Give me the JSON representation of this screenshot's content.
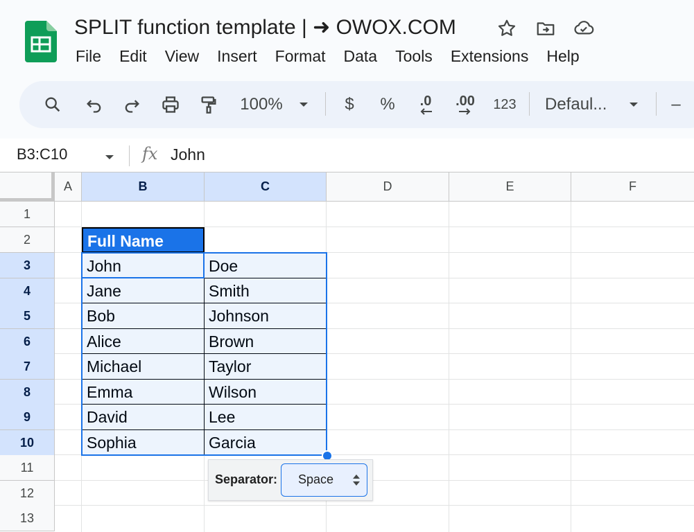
{
  "doc": {
    "title": "SPLIT function template | ➜ OWOX.COM"
  },
  "header_icons": [
    "star-icon",
    "move-to-folder-icon",
    "cloud-saved-icon"
  ],
  "menu": [
    "File",
    "Edit",
    "View",
    "Insert",
    "Format",
    "Data",
    "Tools",
    "Extensions",
    "Help"
  ],
  "toolbar": {
    "zoom": "100%",
    "currency": "$",
    "percent": "%",
    "decrease_decimal": ".0",
    "increase_decimal": ".00",
    "number_format": "123",
    "font": "Defaul...",
    "minus": "–"
  },
  "formula_bar": {
    "range": "B3:C10",
    "content": "John"
  },
  "columns": [
    "A",
    "B",
    "C",
    "D",
    "E",
    "F"
  ],
  "rows": [
    "1",
    "2",
    "3",
    "4",
    "5",
    "6",
    "7",
    "8",
    "9",
    "10",
    "11",
    "12",
    "13"
  ],
  "header_cell": "Full Name",
  "data_rows": [
    [
      "John",
      "Doe"
    ],
    [
      "Jane",
      "Smith"
    ],
    [
      "Bob",
      "Johnson"
    ],
    [
      "Alice",
      "Brown"
    ],
    [
      "Michael",
      "Taylor"
    ],
    [
      "Emma",
      "Wilson"
    ],
    [
      "David",
      "Lee"
    ],
    [
      "Sophia",
      "Garcia"
    ]
  ],
  "split_popup": {
    "label": "Separator:",
    "value": "Space"
  },
  "colors": {
    "sheets_green": "#0f9d58",
    "header_cell_bg": "#1a73e8",
    "selection": "#1a73e8",
    "selected_header_bg": "#d3e3fd"
  }
}
